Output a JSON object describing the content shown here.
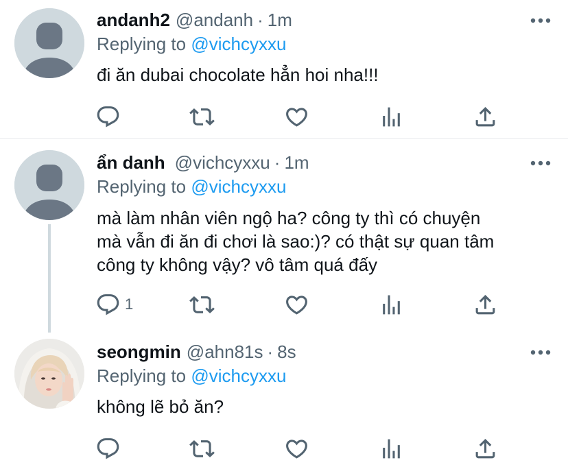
{
  "tweets": [
    {
      "display_name": "andanh2",
      "handle": "@andanh",
      "time": "1m",
      "replying_prefix": "Replying to",
      "replying_handle": "@vichcyxxu",
      "text": "đi ăn dubai chocolate hẳn hoi nha!!!",
      "reply_count": "",
      "avatar": "default-avatar-icon"
    },
    {
      "display_name": "ẩn danh",
      "handle": "@vichcyxxu",
      "time": "1m",
      "replying_prefix": "Replying to",
      "replying_handle": "@vichcyxxu",
      "text": "mà làm nhân viên ngộ ha? công ty thì có chuyện\nmà vẫn đi ăn đi chơi là sao:)? có thật sự quan tâm\ncông ty không vậy? vô tâm quá đấy",
      "reply_count": "1",
      "avatar": "default-avatar-icon"
    },
    {
      "display_name": "seongmin",
      "handle": "@ahn81s",
      "time": "8s",
      "replying_prefix": "Replying to",
      "replying_handle": "@vichcyxxu",
      "text": "không lẽ bỏ ăn?",
      "reply_count": "",
      "avatar": "user-photo-avatar"
    }
  ],
  "separator": "·",
  "colors": {
    "text": "#0f1419",
    "secondary": "#536471",
    "link": "#1d9bf0",
    "avatar_bg": "#cfd9de",
    "avatar_silhouette": "#6b7785",
    "thread_line": "#cfd9de"
  },
  "icons": [
    "reply-icon",
    "retweet-icon",
    "like-icon",
    "analytics-icon",
    "share-icon",
    "more-options-icon"
  ]
}
